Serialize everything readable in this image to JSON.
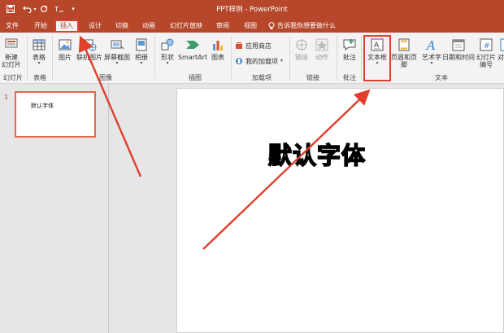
{
  "window": {
    "title": "PPT样例 - PowerPoint"
  },
  "qat": {
    "undo_icon": "undo-icon",
    "redo_icon": "redo-icon",
    "save_icon": "save-icon",
    "format_icon": "touch-mode-icon"
  },
  "tabs": [
    {
      "label": "文件"
    },
    {
      "label": "开始"
    },
    {
      "label": "插入"
    },
    {
      "label": "设计"
    },
    {
      "label": "切换"
    },
    {
      "label": "动画"
    },
    {
      "label": "幻灯片放映"
    },
    {
      "label": "审阅"
    },
    {
      "label": "视图"
    }
  ],
  "tellme": {
    "text": "告诉我你想要做什么"
  },
  "ribbon": {
    "new_slide": "新建\n幻灯片",
    "table": "表格",
    "picture": "图片",
    "online_picture": "联机图片",
    "screenshot": "屏幕截图",
    "album": "相册",
    "shapes": "形状",
    "smartart": "SmartArt",
    "chart": "图表",
    "store": "应用商店",
    "my_addins": "我的加载项",
    "link": "链接",
    "action": "动作",
    "comment": "批注",
    "textbox": "文本框",
    "header_footer": "页眉和页脚",
    "wordart": "艺术字",
    "datetime": "日期和时间",
    "slide_number": "幻灯片\n编号",
    "object": "对"
  },
  "groups": {
    "slides": "幻灯片",
    "tables": "表格",
    "images": "图像",
    "illustrations": "插图",
    "addins": "加载项",
    "links": "链接",
    "comments": "批注",
    "text": "文本"
  },
  "thumbnails": [
    {
      "number": "1",
      "text": "默认字体"
    }
  ],
  "slide": {
    "text": "默认字体"
  }
}
